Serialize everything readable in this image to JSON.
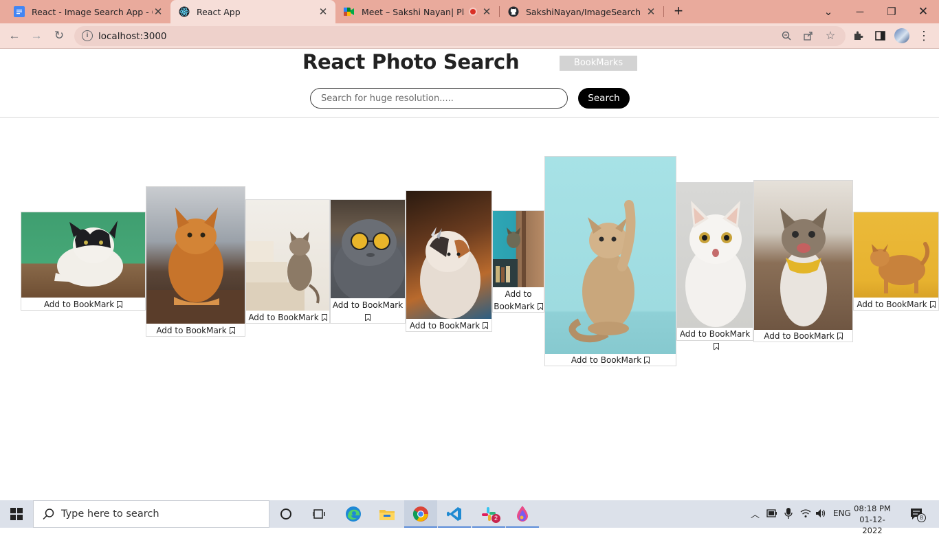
{
  "browser": {
    "tabs": [
      {
        "title": "React - Image Search App - Goog",
        "icon": "google-docs-icon",
        "active": false
      },
      {
        "title": "React App",
        "icon": "react-icon",
        "active": true
      },
      {
        "title": "Meet – Sakshi Nayan| Placem",
        "icon": "google-meet-icon",
        "active": false
      },
      {
        "title": "SakshiNayan/ImageSearch",
        "icon": "github-icon",
        "active": false
      }
    ],
    "url": "localhost:3000"
  },
  "app": {
    "title": "React Photo Search",
    "bookmarks_label": "BookMarks",
    "search": {
      "placeholder": "Search for huge resolution.....",
      "button_label": "Search"
    },
    "bookmark_label": "Add to BookMark",
    "bookmark_label_wrap": [
      "Add to",
      "BookMark"
    ]
  },
  "gallery": [
    {
      "alt": "black-and-white cat on green background"
    },
    {
      "alt": "orange long-haired cat"
    },
    {
      "alt": "tabby cat on stairs"
    },
    {
      "alt": "grey cat wearing sunglasses"
    },
    {
      "alt": "fluffy cat with butterfly"
    },
    {
      "alt": "cat peeking from door"
    },
    {
      "alt": "kitten raising paw on teal background"
    },
    {
      "alt": "white kitten surprised"
    },
    {
      "alt": "cat with yellow scarf meowing"
    },
    {
      "alt": "orange cat on yellow background"
    }
  ],
  "taskbar": {
    "search_placeholder": "Type here to search",
    "language": "ENG",
    "time": "08:18 PM",
    "date": "01-12-2022",
    "slack_badge": "2",
    "notification_count": "8"
  }
}
